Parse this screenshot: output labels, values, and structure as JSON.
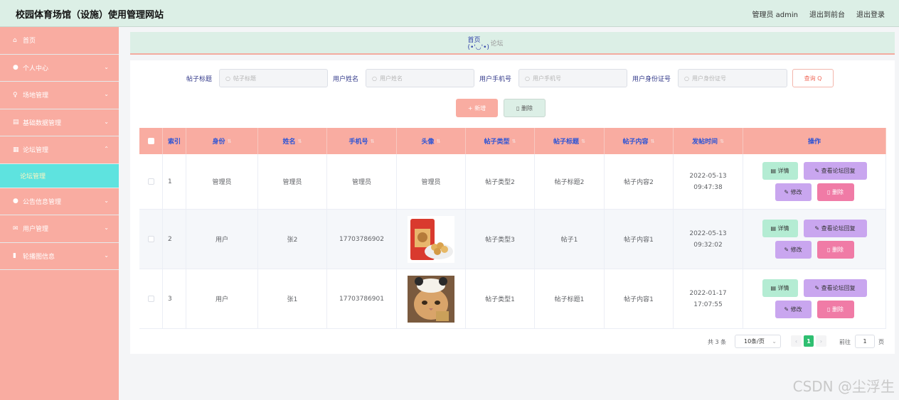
{
  "header": {
    "title": "校园体育场馆（设施）使用管理网站",
    "user": "管理员 admin",
    "to_front": "退出到前台",
    "logout": "退出登录"
  },
  "sidebar": {
    "items": [
      {
        "label": "首页",
        "icon": "home-icon",
        "glyph": "⌂",
        "arrow": ""
      },
      {
        "label": "个人中心",
        "icon": "user-icon",
        "glyph": "●",
        "arrow": "⌄"
      },
      {
        "label": "场地管理",
        "icon": "microphone-icon",
        "glyph": "♀",
        "arrow": "⌄"
      },
      {
        "label": "基础数据管理",
        "icon": "briefcase-icon",
        "glyph": "▤",
        "arrow": "⌄"
      },
      {
        "label": "论坛管理",
        "icon": "suitcase-icon",
        "glyph": "▦",
        "arrow": "⌃"
      },
      {
        "label": "论坛管理",
        "icon": "",
        "glyph": "",
        "arrow": "",
        "sub": true
      },
      {
        "label": "公告信息管理",
        "icon": "location-icon",
        "glyph": "●",
        "arrow": "⌄"
      },
      {
        "label": "用户管理",
        "icon": "mail-icon",
        "glyph": "✉",
        "arrow": "⌄"
      },
      {
        "label": "轮播图信息",
        "icon": "bar-chart-icon",
        "glyph": "▮",
        "arrow": "⌄"
      }
    ]
  },
  "breadcrumb": {
    "home": "首页 (•'◡'•)",
    "current": "论坛"
  },
  "search": {
    "fields": [
      {
        "label": "帖子标题",
        "placeholder": "帖子标题"
      },
      {
        "label": "用户姓名",
        "placeholder": "用户姓名"
      },
      {
        "label": "用户手机号",
        "placeholder": "用户手机号"
      },
      {
        "label": "用户身份证号",
        "placeholder": "用户身份证号"
      }
    ],
    "query_label": "查询",
    "add_label": "新增",
    "delete_label": "删除"
  },
  "table": {
    "headers": [
      "索引",
      "身份",
      "姓名",
      "手机号",
      "头像",
      "帖子类型",
      "帖子标题",
      "帖子内容",
      "发帖时间",
      "操作"
    ],
    "rows": [
      {
        "index": "1",
        "role": "管理员",
        "name": "管理员",
        "phone": "管理员",
        "avatar": "管理员",
        "avatar_type": "text",
        "type": "帖子类型2",
        "title": "帖子标题2",
        "content": "帖子内容2",
        "time": "2022-05-13 09:47:38"
      },
      {
        "index": "2",
        "role": "用户",
        "name": "张2",
        "phone": "17703786902",
        "avatar": "",
        "avatar_type": "snack",
        "type": "帖子类型3",
        "title": "帖子1",
        "content": "帖子内容1",
        "time": "2022-05-13 09:32:02"
      },
      {
        "index": "3",
        "role": "用户",
        "name": "张1",
        "phone": "17703786901",
        "avatar": "",
        "avatar_type": "cat",
        "type": "帖子类型1",
        "title": "帖子标题1",
        "content": "帖子内容1",
        "time": "2022-01-17 17:07:55"
      }
    ],
    "ops": {
      "detail": "详情",
      "reply": "查看论坛回复",
      "edit": "修改",
      "remove": "删除"
    }
  },
  "pager": {
    "total": "共 3 条",
    "size": "10条/页",
    "current": "1",
    "goto": "前往",
    "page_input": "1",
    "unit": "页"
  },
  "watermark": "CSDN @尘浮生",
  "colors": {
    "sidebar": "#f9aca1",
    "header": "#dcefe6",
    "active_sub": "#5ee3df",
    "pager_active": "#2fbf71"
  }
}
